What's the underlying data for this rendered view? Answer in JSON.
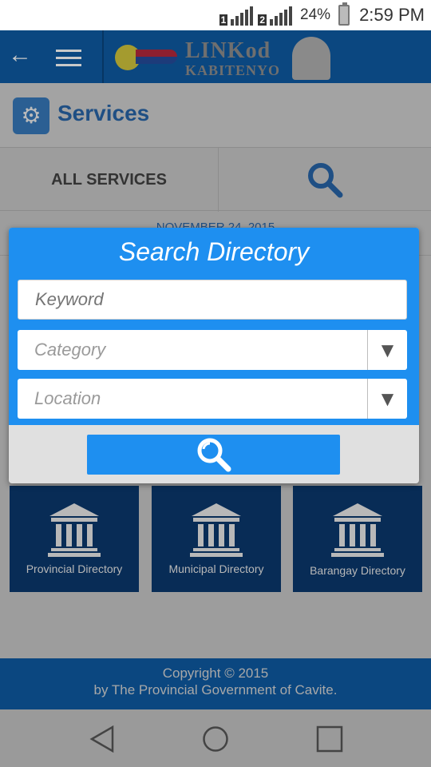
{
  "status_bar": {
    "sim1": "1",
    "sim2": "2",
    "battery_percent": "24%",
    "time": "2:59 PM"
  },
  "app_bar": {
    "back_icon": "arrow-left-icon",
    "menu_icon": "hamburger-menu-icon",
    "logo_line1": "LINKod",
    "logo_line2": "KABITENYO"
  },
  "services": {
    "title": "Services",
    "icon": "gears-icon",
    "tab_all_label": "ALL SERVICES",
    "tab_search_icon": "search-icon",
    "date": "NOVEMBER 24, 2015"
  },
  "dialog": {
    "title": "Search Directory",
    "keyword_placeholder": "Keyword",
    "category_placeholder": "Category",
    "location_placeholder": "Location",
    "search_button_icon": "search-icon"
  },
  "directory_tiles": [
    {
      "label": "Provincial Directory",
      "icon": "government-building-icon"
    },
    {
      "label": "Municipal Directory",
      "icon": "government-building-icon"
    },
    {
      "label": "Barangay Directory",
      "icon": "government-building-icon"
    }
  ],
  "footer": {
    "line1": "Copyright © 2015",
    "line2": "by The Provincial Government of Cavite."
  },
  "colors": {
    "dialog_blue": "#1e8ff0",
    "app_bar_blue": "#0b4780",
    "tile_navy": "#082c56",
    "overlay_grey": "#9d9d9d"
  }
}
